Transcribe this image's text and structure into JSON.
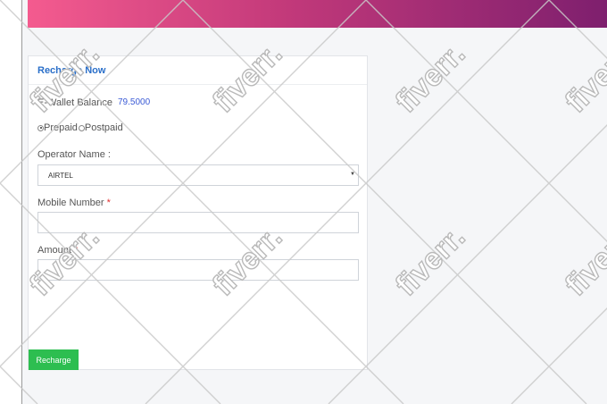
{
  "recharge": {
    "title": "Recharge Now",
    "wallet_label": "E-Wallet Balance",
    "wallet_value": "79.5000",
    "plan_options": [
      {
        "label": "Prepaid",
        "selected": true
      },
      {
        "label": "Postpaid",
        "selected": false
      }
    ],
    "operator_label": "Operator Name :",
    "operator_value": "AIRTEL",
    "mobile_label": "Mobile Number",
    "mobile_value": "",
    "amount_label": "Amount",
    "amount_value": "",
    "required_mark": "*",
    "button_label": "Recharge"
  },
  "watermark": {
    "text": "fiverr."
  },
  "colors": {
    "header_start": "#f45b8f",
    "header_end": "#7e1f6e",
    "title": "#2a6fc9",
    "button": "#2dbe50",
    "required": "#e03131"
  },
  "icons": [
    "radio-selected-icon",
    "radio-unselected-icon",
    "chevron-down-icon"
  ]
}
